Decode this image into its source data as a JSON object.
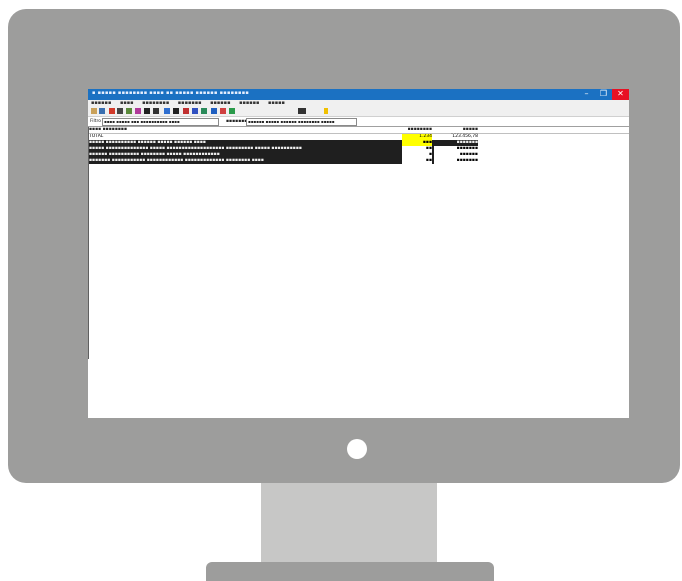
{
  "window": {
    "title": "▪ ▪▪▪▪▪ ▪▪▪▪▪▪▪▪ ▪▪▪▪ ▪▪ ▪▪▪▪▪ ▪▪▪▪▪▪ ▪▪▪▪▪▪▪▪",
    "minimize": "–",
    "maximize": "❐",
    "close": "✕"
  },
  "menu": [
    "▪▪▪▪▪▪",
    "▪▪▪▪",
    "▪▪▪▪▪▪▪▪",
    "▪▪▪▪▪▪▪",
    "▪▪▪▪▪▪",
    "▪▪▪▪▪▪",
    "▪▪▪▪▪"
  ],
  "fields": {
    "label1": "Filtro",
    "value1": "▪▪▪▪ ▪▪▪▪▪ ▪▪▪ ▪▪▪▪▪▪▪▪▪▪ ▪▪▪▪",
    "label2": "▪▪▪▪▪▪▪",
    "value2": "▪▪▪▪▪▪ ▪▪▪▪▪ ▪▪▪▪▪▪ ▪▪▪▪▪▪▪▪ ▪▪▪▪▪"
  },
  "columns": {
    "desc": "▪▪▪▪ ▪▪▪▪▪▪▪▪",
    "qty": "▪▪▪▪▪▪▪▪",
    "total": "▪▪▪▪▪ ▪▪▪▪▪▪▪▪▪"
  },
  "rows": [
    {
      "desc": "TOTAL",
      "qty": "1.234",
      "total": "123.456,78"
    },
    {
      "desc": "▪▪▪▪▪ ▪▪▪▪▪▪▪▪▪▪ ▪▪▪▪▪▪ ▪▪▪▪▪ ▪▪▪▪▪▪ ▪▪▪▪",
      "qty": "▪▪▪",
      "total": "▪▪▪▪▪▪▪"
    },
    {
      "desc": "▪▪▪▪▪ ▪▪▪▪▪▪▪▪▪▪▪▪▪▪ ▪▪▪▪▪ ▪▪▪▪▪▪▪▪▪▪▪▪▪▪▪▪▪▪▪ ▪▪▪▪▪▪▪▪▪ ▪▪▪▪▪ ▪▪▪▪▪▪▪▪▪▪",
      "qty": "▪▪",
      "total": "▪▪▪▪▪▪▪"
    },
    {
      "desc": "▪▪▪▪▪▪ ▪▪▪▪▪▪▪▪▪▪ ▪▪▪▪▪▪▪▪ ▪▪▪▪▪ ▪▪▪▪▪▪▪▪▪▪▪▪",
      "qty": "▪",
      "total": "▪▪▪▪▪▪"
    },
    {
      "desc": "▪▪▪▪▪▪▪ ▪▪▪▪▪▪▪▪▪▪▪ ▪▪▪▪▪▪▪▪▪▪▪▪ ▪▪▪▪▪▪▪▪▪▪▪▪▪ ▪▪▪▪▪▪▪▪ ▪▪▪▪",
      "qty": "▪▪",
      "total": "▪▪▪▪▪▪▪"
    }
  ],
  "toolbar_icons": [
    "new-icon",
    "open-icon",
    "filter-icon",
    "sort-icon",
    "undo-icon",
    "export-icon",
    "print-icon",
    "sum-icon",
    "chart-icon",
    "bar-chart-icon",
    "funnel-icon",
    "tools-icon",
    "grid-icon",
    "calculator-icon",
    "info-icon"
  ],
  "colors": {
    "titlebar": "#1b71c2",
    "close": "#e81123",
    "highlight": "#ffff00",
    "dark_row": "#1f1f1f",
    "monitor": "#9d9d9c"
  }
}
